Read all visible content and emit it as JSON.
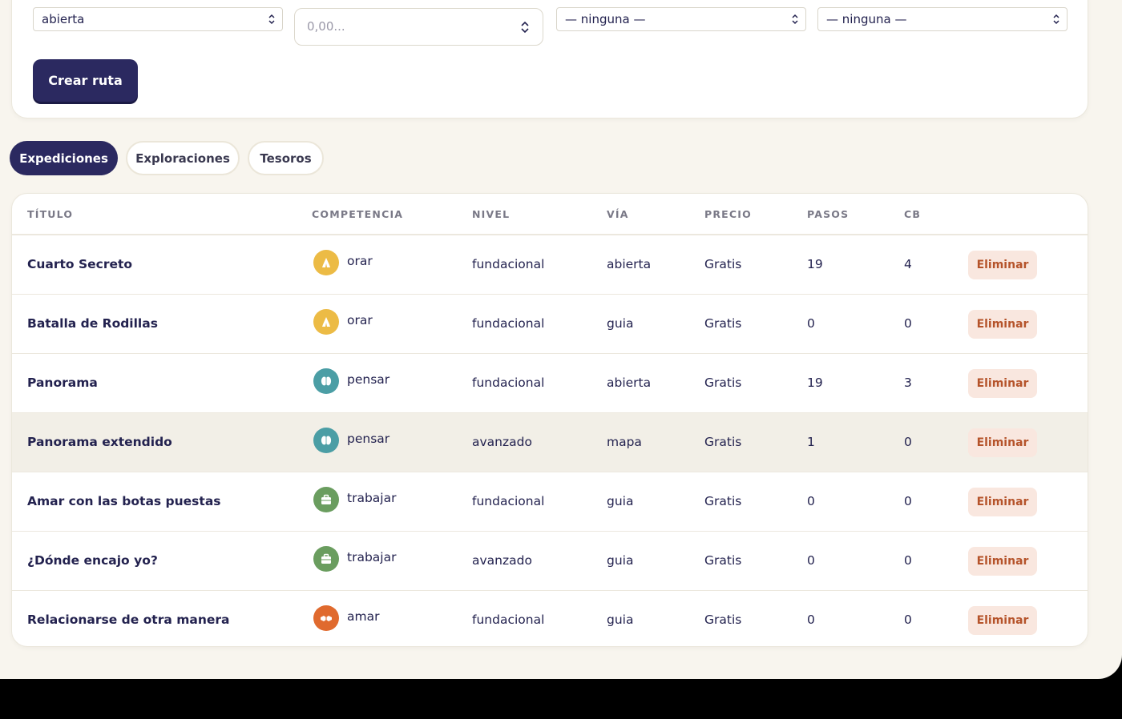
{
  "form": {
    "via_select": "abierta",
    "price_placeholder": "0,00...",
    "select_three": "— ninguna —",
    "select_four": "— ninguna —",
    "create_button": "Crear ruta"
  },
  "tabs": [
    {
      "label": "Expediciones",
      "active": true
    },
    {
      "label": "Exploraciones",
      "active": false
    },
    {
      "label": "Tesoros",
      "active": false
    }
  ],
  "table": {
    "headers": [
      "TÍTULO",
      "COMPETENCIA",
      "NIVEL",
      "VÍA",
      "PRECIO",
      "PASOS",
      "CB"
    ],
    "rows": [
      {
        "title": "Cuarto Secreto",
        "competencia": "orar",
        "icon": "praying-hands-icon",
        "icon_color": "#ecbb45",
        "nivel": "fundacional",
        "via": "abierta",
        "precio": "Gratis",
        "pasos": "19",
        "cb": "4",
        "action": "Eliminar"
      },
      {
        "title": "Batalla de Rodillas",
        "competencia": "orar",
        "icon": "praying-hands-icon",
        "icon_color": "#ecbb45",
        "nivel": "fundacional",
        "via": "guia",
        "precio": "Gratis",
        "pasos": "0",
        "cb": "0",
        "action": "Eliminar"
      },
      {
        "title": "Panorama",
        "competencia": "pensar",
        "icon": "brain-icon",
        "icon_color": "#4b9ea5",
        "nivel": "fundacional",
        "via": "abierta",
        "precio": "Gratis",
        "pasos": "19",
        "cb": "3",
        "action": "Eliminar"
      },
      {
        "title": "Panorama extendido",
        "competencia": "pensar",
        "icon": "brain-icon",
        "icon_color": "#4b9ea5",
        "nivel": "avanzado",
        "via": "mapa",
        "precio": "Gratis",
        "pasos": "1",
        "cb": "0",
        "action": "Eliminar"
      },
      {
        "title": "Amar con las botas puestas",
        "competencia": "trabajar",
        "icon": "briefcase-icon",
        "icon_color": "#6a9d5f",
        "nivel": "fundacional",
        "via": "guia",
        "precio": "Gratis",
        "pasos": "0",
        "cb": "0",
        "action": "Eliminar"
      },
      {
        "title": "¿Dónde encajo yo?",
        "competencia": "trabajar",
        "icon": "briefcase-icon",
        "icon_color": "#6a9d5f",
        "nivel": "avanzado",
        "via": "guia",
        "precio": "Gratis",
        "pasos": "0",
        "cb": "0",
        "action": "Eliminar"
      },
      {
        "title": "Relacionarse de otra manera",
        "competencia": "amar",
        "icon": "handshake-icon",
        "icon_color": "#e06a2e",
        "nivel": "fundacional",
        "via": "guia",
        "precio": "Gratis",
        "pasos": "0",
        "cb": "0",
        "action": "Eliminar"
      }
    ]
  },
  "colors": {
    "primary": "#2b2960",
    "background": "#f8f5ee",
    "delete_bg": "#f9e7df",
    "delete_text": "#b5532a"
  }
}
